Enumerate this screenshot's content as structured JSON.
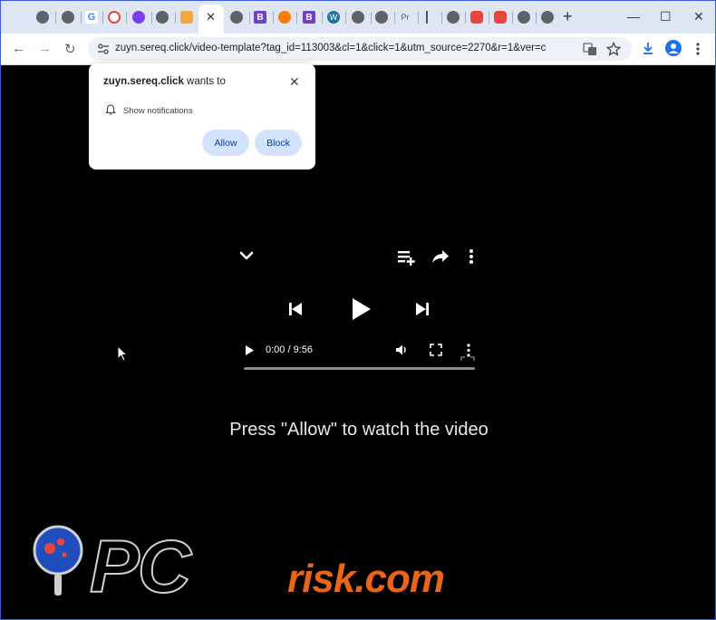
{
  "browser": {
    "tabs_count": 20,
    "active_tab_close": "✕",
    "new_tab": "+",
    "window": {
      "minimize": "—",
      "maximize": "☐",
      "close": "✕"
    },
    "tab_labels": {
      "google": "G",
      "bootstrap1": "B",
      "bootstrap2": "B",
      "wp": "W",
      "pr": "Pr"
    }
  },
  "toolbar": {
    "back": "←",
    "forward": "→",
    "reload": "↻",
    "url": "zuyn.sereq.click/video-template?tag_id=113003&cl=1&click=1&utm_source=2270&r=1&ver=c"
  },
  "popup": {
    "site": "zuyn.sereq.click",
    "wants_to": " wants to",
    "permission": "Show notifications",
    "allow": "Allow",
    "block": "Block",
    "close": "✕"
  },
  "player": {
    "time": "0:00 / 9:56"
  },
  "message": "Press \"Allow\" to watch the video",
  "watermark": {
    "left": "PC",
    "right": "risk.com"
  },
  "colors": {
    "accent": "#1a73e8",
    "button_bg": "#d3e3fd",
    "watermark_orange": "#e8651a"
  }
}
